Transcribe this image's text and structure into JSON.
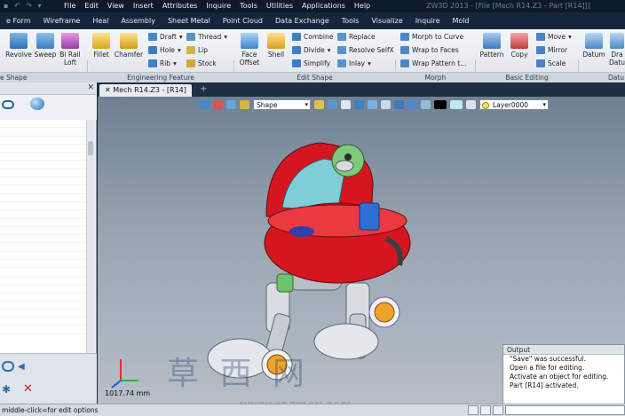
{
  "window": {
    "title": "ZW3D 2013 - [File [Mech R14.Z3 - Part [R14]]]",
    "menu": [
      "File",
      "Edit",
      "View",
      "Insert",
      "Attributes",
      "Inquire",
      "Tools",
      "Utilities",
      "Applications",
      "Help"
    ]
  },
  "ribbon_tabs": [
    "e Form",
    "Wireframe",
    "Heal",
    "Assembly",
    "Sheet Metal",
    "Point Cloud",
    "Data Exchange",
    "Tools",
    "Visualize",
    "Inquire",
    "Mold"
  ],
  "ribbon": {
    "revolve": "Revolve",
    "sweep": "Sweep",
    "birail1": "Bi Rail",
    "birail2": "Loft",
    "fillet": "Fillet",
    "chamfer": "Chamfer",
    "draft": "Draft",
    "hole": "Hole",
    "rib": "Rib",
    "thread": "Thread",
    "lip": "Lip",
    "stock": "Stock",
    "faceoffset1": "Face",
    "faceoffset2": "Offset",
    "shell": "Shell",
    "combine": "Combine",
    "divide": "Divide",
    "simplify": "Simplify",
    "replace": "Replace",
    "resolve": "Resolve SelfX",
    "inlay": "Inlay",
    "morphcurve": "Morph to Curve",
    "wrapfaces": "Wrap to Faces",
    "wrappattern": "Wrap Pattern t...",
    "pattern": "Pattern",
    "copy": "Copy",
    "move": "Move",
    "mirror": "Mirror",
    "scale": "Scale",
    "datum": "Datum",
    "datum2a": "Dra",
    "datum2b": "Datu"
  },
  "groups": {
    "shape": "e Shape",
    "engineering": "Engineering Feature",
    "editshape": "Edit Shape",
    "morph": "Morph",
    "basicedit": "Basic Editing",
    "datum": "Datu"
  },
  "document": {
    "tab": "Mech R14.Z3 - [R14]",
    "add": "+"
  },
  "viewport": {
    "filter": "Shape",
    "layer": "Layer0000",
    "measure": "1017.74 mm",
    "watermark": "草 西 网",
    "watermark_url": "www.cnzmox.com"
  },
  "output": {
    "title": "Output",
    "lines": [
      "\"Save\" was successful.",
      "Open a file for editing.",
      "Activate an object for editing.",
      "Part [R14] activated."
    ]
  },
  "status": {
    "text": "middle-click=for edit options"
  },
  "colors": {
    "body": "#d51620",
    "accent": "#2e7bd6",
    "background_top": "#6f8093",
    "background_bottom": "#b9c1c9"
  }
}
